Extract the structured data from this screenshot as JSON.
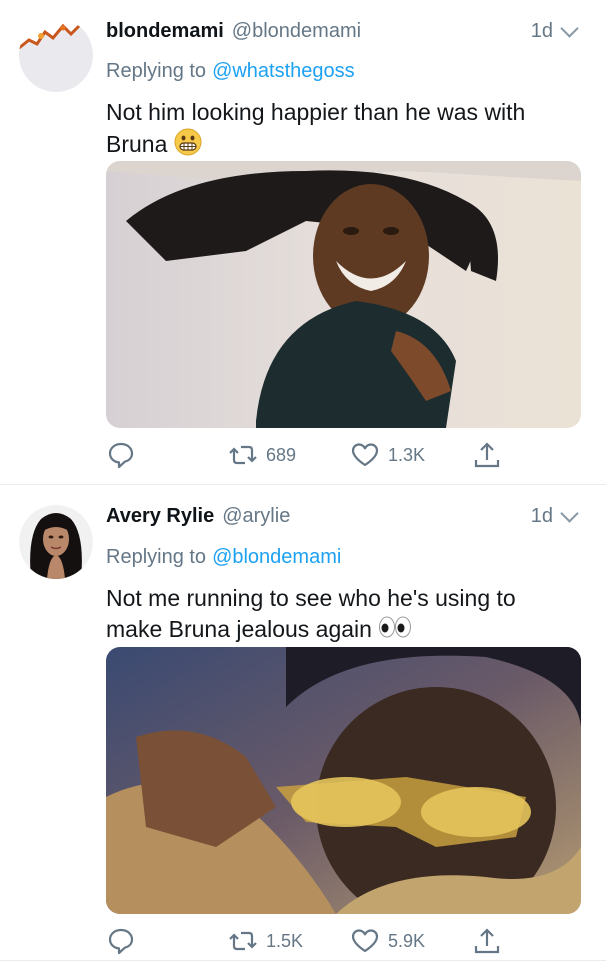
{
  "tweets": [
    {
      "name": "blondemami",
      "handle": "@blondemami",
      "age": "1d",
      "replying_label": "Replying to",
      "replying_to": "@whatsthegoss",
      "text": "Not him looking happier than he was with Bruna",
      "emoji": "grimacing-face",
      "retweets": "689",
      "likes": "1.3K"
    },
    {
      "name": "Avery Rylie",
      "handle": "@arylie",
      "age": "1d",
      "replying_label": "Replying to",
      "replying_to": "@blondemami",
      "text": "Not me running to see who he's using to make Bruna jealous again",
      "emoji": "eyes",
      "retweets": "1.5K",
      "likes": "5.9K"
    }
  ],
  "colors": {
    "link": "#1da1f2",
    "secondary": "#657786",
    "divider": "#e6ecf0"
  }
}
